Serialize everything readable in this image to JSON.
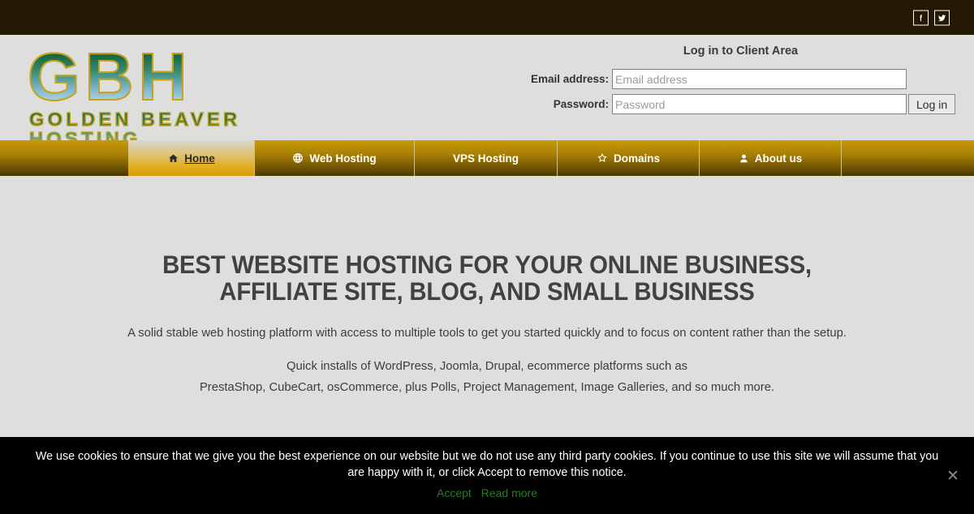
{
  "topbar": {
    "social": [
      {
        "name": "facebook-icon",
        "label": "Facebook"
      },
      {
        "name": "twitter-icon",
        "label": "Twitter"
      }
    ]
  },
  "header": {
    "logo": {
      "main": "GBH",
      "sub": "GOLDEN BEAVER HOSTING"
    },
    "login": {
      "title": "Log in to Client Area",
      "email_label": "Email address:",
      "email_placeholder": "Email address",
      "email_value": "",
      "password_label": "Password:",
      "password_placeholder": "Password",
      "password_value": "",
      "submit_label": "Log in"
    }
  },
  "nav": {
    "items": [
      {
        "label": "Home",
        "icon": "home-icon",
        "active": true,
        "width": 156
      },
      {
        "label": "Web Hosting",
        "icon": "globe-icon",
        "active": false,
        "width": 198
      },
      {
        "label": "VPS Hosting",
        "icon": "",
        "active": false,
        "width": 177
      },
      {
        "label": "Domains",
        "icon": "star-icon",
        "active": false,
        "width": 176
      },
      {
        "label": "About us",
        "icon": "user-icon",
        "active": false,
        "width": 176
      }
    ]
  },
  "hero": {
    "heading_line1": "BEST WEBSITE HOSTING FOR YOUR ONLINE BUSINESS,",
    "heading_line2": "AFFILIATE SITE, BLOG, AND SMALL BUSINESS",
    "paragraph1": "A solid stable web hosting platform with access to multiple tools to get you started quickly and to focus on content rather than the setup.",
    "paragraph2": "Quick installs of WordPress, Joomla, Drupal, ecommerce platforms such as",
    "paragraph3": "PrestaShop, CubeCart, osCommerce, plus Polls, Project Management, Image Galleries, and so much more."
  },
  "cookie": {
    "message": "We use cookies to ensure that we give you the best experience on our website but we do not use any third party cookies. If you continue to use this site we will assume that you are happy with it, or click Accept to remove this notice.",
    "accept_label": "Accept",
    "readmore_label": "Read more",
    "close_label": "✕"
  },
  "colors": {
    "topbar_bg": "#241a04",
    "page_bg": "#dededd",
    "nav_gold": "#a87f05",
    "nav_active_gold": "#e2ab16",
    "logo_outline": "#c8a217",
    "cookie_bg": "#000000",
    "cookie_link": "#2b7a2b",
    "heading_text": "#414141"
  }
}
